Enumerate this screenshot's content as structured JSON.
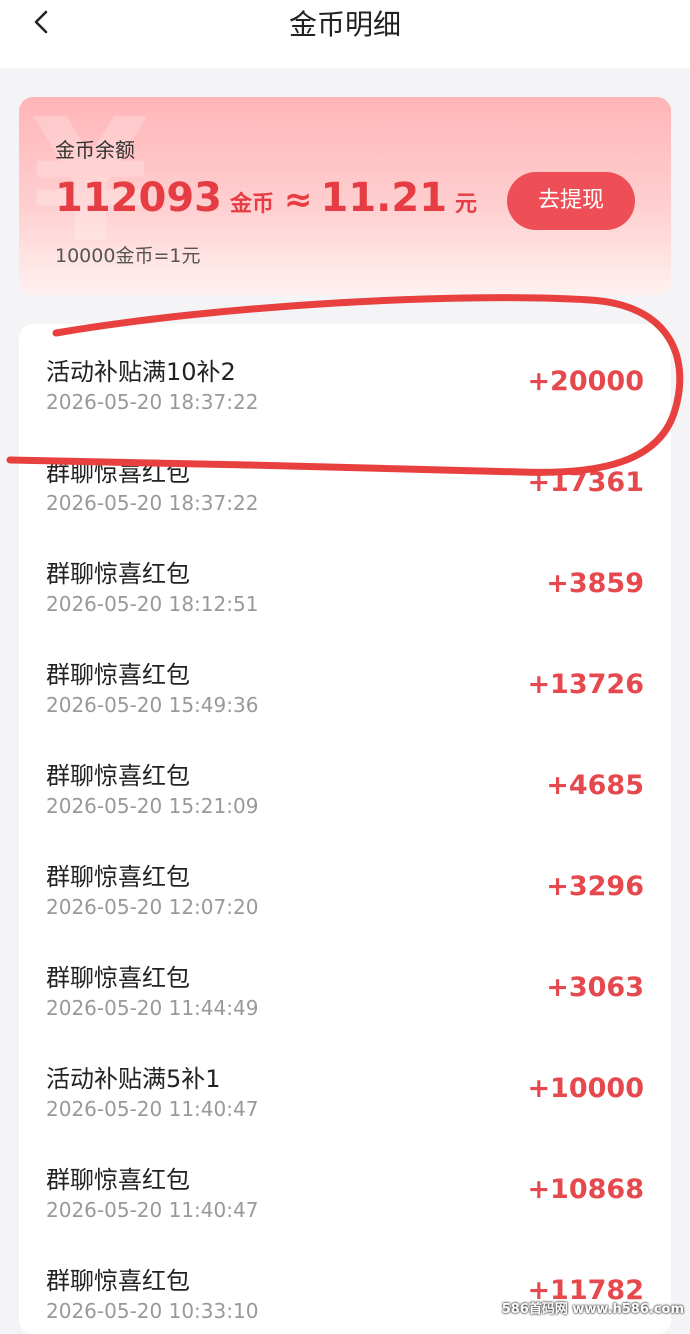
{
  "header": {
    "title": "金币明细",
    "back_icon": "chevron-left-icon"
  },
  "balance": {
    "label": "金币余额",
    "coins": "112093",
    "coins_unit": "金币",
    "approx": "≈",
    "cash": "11.21",
    "cash_unit": "元",
    "rate": "10000金币=1元",
    "withdraw_label": "去提现",
    "watermark_symbol": "¥"
  },
  "records": [
    {
      "title": "活动补贴满10补2",
      "time": "2026-05-20 18:37:22",
      "amount": "+20000"
    },
    {
      "title": "群聊惊喜红包",
      "time": "2026-05-20 18:37:22",
      "amount": "+17361"
    },
    {
      "title": "群聊惊喜红包",
      "time": "2026-05-20 18:12:51",
      "amount": "+3859"
    },
    {
      "title": "群聊惊喜红包",
      "time": "2026-05-20 15:49:36",
      "amount": "+13726"
    },
    {
      "title": "群聊惊喜红包",
      "time": "2026-05-20 15:21:09",
      "amount": "+4685"
    },
    {
      "title": "群聊惊喜红包",
      "time": "2026-05-20 12:07:20",
      "amount": "+3296"
    },
    {
      "title": "群聊惊喜红包",
      "time": "2026-05-20 11:44:49",
      "amount": "+3063"
    },
    {
      "title": "活动补贴满5补1",
      "time": "2026-05-20 11:40:47",
      "amount": "+10000"
    },
    {
      "title": "群聊惊喜红包",
      "time": "2026-05-20 11:40:47",
      "amount": "+10868"
    },
    {
      "title": "群聊惊喜红包",
      "time": "2026-05-20 10:33:10",
      "amount": "+11782"
    }
  ],
  "colors": {
    "accent": "#ee4f57",
    "amount": "#e5484d",
    "annotation": "#e8403f"
  },
  "watermark": "586首码网 www.h586.com"
}
